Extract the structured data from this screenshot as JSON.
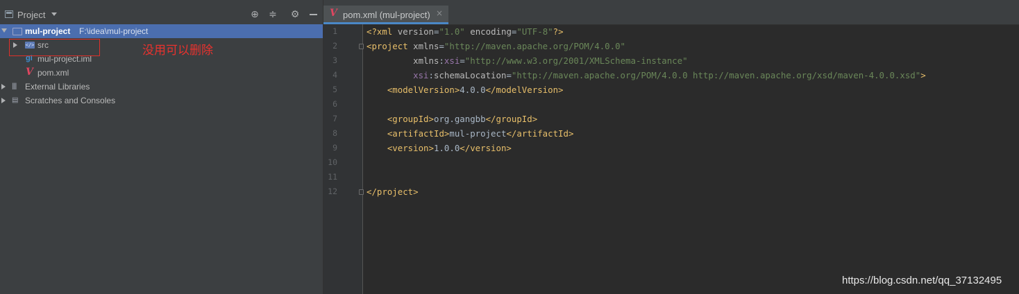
{
  "project_panel": {
    "title": "Project",
    "tree": [
      {
        "label": "mul-project",
        "path": "F:\\idea\\mul-project",
        "icon": "folder-icon",
        "expanded": true,
        "selected": true
      },
      {
        "label": "src",
        "icon": "source-folder-icon",
        "expanded": false
      },
      {
        "label": "mul-project.iml",
        "icon": "iml-file-icon"
      },
      {
        "label": "pom.xml",
        "icon": "maven-icon"
      },
      {
        "label": "External Libraries",
        "icon": "libraries-icon",
        "expanded": false
      },
      {
        "label": "Scratches and Consoles",
        "icon": "scratches-icon",
        "expanded": false
      }
    ],
    "annotation": "没用可以删除"
  },
  "editor": {
    "tab": {
      "title": "pom.xml (mul-project)",
      "close": "×"
    },
    "line_numbers": [
      "1",
      "2",
      "3",
      "4",
      "5",
      "6",
      "7",
      "8",
      "9",
      "10",
      "11",
      "12"
    ],
    "lines": [
      [
        [
          "t-tag",
          "<?xml "
        ],
        [
          "t-attr",
          "version"
        ],
        [
          "t-txt",
          "="
        ],
        [
          "t-str",
          "\"1.0\""
        ],
        [
          "t-txt",
          " "
        ],
        [
          "t-attr",
          "encoding"
        ],
        [
          "t-txt",
          "="
        ],
        [
          "t-str",
          "\"UTF-8\""
        ],
        [
          "t-tag",
          "?>"
        ]
      ],
      [
        [
          "t-tag",
          "<project "
        ],
        [
          "t-attr",
          "xmlns"
        ],
        [
          "t-txt",
          "="
        ],
        [
          "t-str",
          "\"http://maven.apache.org/POM/4.0.0\""
        ]
      ],
      [
        [
          "t-txt",
          "         "
        ],
        [
          "t-attr",
          "xmlns"
        ],
        [
          "t-txt",
          ":"
        ],
        [
          "t-ns",
          "xsi"
        ],
        [
          "t-txt",
          "="
        ],
        [
          "t-str",
          "\"http://www.w3.org/2001/XMLSchema-instance\""
        ]
      ],
      [
        [
          "t-txt",
          "         "
        ],
        [
          "t-ns",
          "xsi"
        ],
        [
          "t-txt",
          ":"
        ],
        [
          "t-attr",
          "schemaLocation"
        ],
        [
          "t-txt",
          "="
        ],
        [
          "t-str",
          "\"http://maven.apache.org/POM/4.0.0 http://maven.apache.org/xsd/maven-4.0.0.xsd\""
        ],
        [
          "t-tag",
          ">"
        ]
      ],
      [
        [
          "t-txt",
          "    "
        ],
        [
          "t-tag",
          "<modelVersion>"
        ],
        [
          "t-txt",
          "4.0.0"
        ],
        [
          "t-tag",
          "</modelVersion>"
        ]
      ],
      [],
      [
        [
          "t-txt",
          "    "
        ],
        [
          "t-tag",
          "<groupId>"
        ],
        [
          "t-txt",
          "org.gangbb"
        ],
        [
          "t-tag",
          "</groupId>"
        ]
      ],
      [
        [
          "t-txt",
          "    "
        ],
        [
          "t-tag",
          "<artifactId>"
        ],
        [
          "t-txt",
          "mul-project"
        ],
        [
          "t-tag",
          "</artifactId>"
        ]
      ],
      [
        [
          "t-txt",
          "    "
        ],
        [
          "t-tag",
          "<version>"
        ],
        [
          "t-txt",
          "1.0.0"
        ],
        [
          "t-tag",
          "</version>"
        ]
      ],
      [],
      [],
      [
        [
          "t-tag",
          "</project>"
        ]
      ]
    ]
  },
  "watermark": "https://blog.csdn.net/qq_37132495",
  "colors": {
    "selection": "#4b6eaf",
    "annotation_red": "#e8322e",
    "tag": "#e8bf6a",
    "string": "#6a8759",
    "namespace": "#9876aa"
  }
}
